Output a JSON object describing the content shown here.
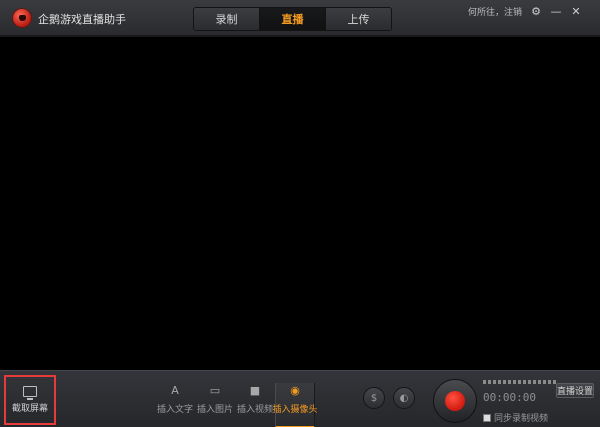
{
  "app": {
    "title": "企鹅游戏直播助手"
  },
  "tabs": [
    {
      "label": "录制"
    },
    {
      "label": "直播"
    },
    {
      "label": "上传"
    }
  ],
  "header": {
    "login_text": "何所往，注销",
    "settings_icon": "⚙",
    "minimize_icon": "—",
    "close_icon": "✕"
  },
  "toolbar": {
    "capture_label": "截取屏幕",
    "tools": [
      {
        "glyph": "A",
        "label": "插入文字"
      },
      {
        "glyph": "▭",
        "label": "插入图片"
      },
      {
        "glyph": "■",
        "label": "插入视频"
      },
      {
        "glyph": "◉",
        "label": "插入摄像头"
      }
    ],
    "left_circle_glyph": "$",
    "right_circle_glyph": "◐",
    "timer": "00:00:00",
    "sync_label": "同步录制视频",
    "settings_label": "直播设置"
  },
  "colors": {
    "accent": "#f39a21",
    "record": "#e0261b",
    "highlight": "#e53b3b"
  }
}
